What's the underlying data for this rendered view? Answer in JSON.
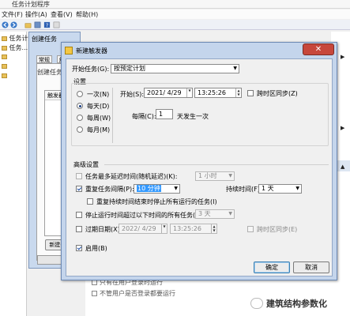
{
  "background_window": {
    "title": "任务计划程序",
    "menu": [
      "文件(F)",
      "操作(A)",
      "查看(V)",
      "帮助(H)"
    ],
    "tree": [
      "任务计划...",
      "任务...",
      "",
      "",
      ""
    ],
    "bottom_lines": [
      "只有在用户登录时运行",
      "不管用户是否登录都要运行"
    ]
  },
  "create_task_dialog": {
    "title": "创建任务",
    "tabs": [
      "常规",
      "触"
    ],
    "label": "创建任务...",
    "list_header": "触发器",
    "new_button": "新建(N)..."
  },
  "trigger_dialog": {
    "title": "新建触发器",
    "close_glyph": "✕",
    "begin_task_label": "开始任务(G):",
    "begin_task_value": "按预定计划",
    "settings_label": "设置",
    "schedule_options": [
      {
        "label": "一次(N)",
        "selected": false
      },
      {
        "label": "每天(D)",
        "selected": true
      },
      {
        "label": "每周(W)",
        "selected": false
      },
      {
        "label": "每月(M)",
        "selected": false
      }
    ],
    "start_label": "开始(S):",
    "start_date": "2021/ 4/29",
    "start_time": "13:25:26",
    "sync_timezone_label": "跨时区同步(Z)",
    "recur_label": "每隔(C):",
    "recur_value": "1",
    "recur_unit": "天发生一次",
    "advanced_label": "高级设置",
    "delay_label": "任务最多延迟时间(随机延迟)(K):",
    "delay_value": "1 小时",
    "repeat_label": "重复任务间隔(P):",
    "repeat_value": "10 分钟",
    "duration_label": "持续时间(F):",
    "duration_value": "1 天",
    "stop_running_label": "重复持续时间结束时停止所有运行的任务(I)",
    "stop_longer_label": "停止运行时间超过以下时间的所有任务(L):",
    "stop_longer_value": "3 天",
    "expire_label": "过期日期(X):",
    "expire_date": "2022/ 4/29",
    "expire_time": "13:25:26",
    "expire_sync_label": "跨时区同步(E)",
    "enabled_label": "启用(B)",
    "ok_label": "确定",
    "cancel_label": "取消"
  },
  "watermark": {
    "text": "建筑结构参数化"
  },
  "colors": {
    "selection": "#3399ff",
    "dialog_frame": "#c4d5ec",
    "close_button": "#c7473b"
  }
}
